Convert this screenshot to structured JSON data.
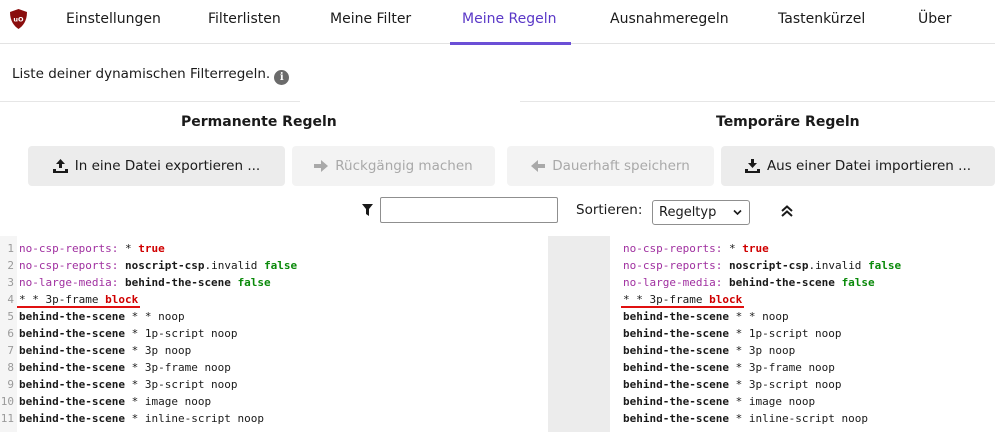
{
  "nav": {
    "logo_icon": "ublock-origin-shield-icon",
    "tabs": [
      "Einstellungen",
      "Filterlisten",
      "Meine Filter",
      "Meine Regeln",
      "Ausnahmeregeln",
      "Tastenkürzel",
      "Über"
    ],
    "active_tab": "Meine Regeln"
  },
  "description": "Liste deiner dynamischen Filterregeln.",
  "columns": {
    "permanent_title": "Permanente Regeln",
    "temporary_title": "Temporäre Regeln"
  },
  "buttons": {
    "export": "In eine Datei exportieren ...",
    "revert": "Rückgängig machen",
    "commit": "Dauerhaft speichern",
    "import": "Aus einer Datei importieren ..."
  },
  "filter": {
    "value": "",
    "placeholder": ""
  },
  "sort": {
    "label": "Sortieren:",
    "selected": "Regeltyp"
  },
  "colors": {
    "accent": "#6b4fd6",
    "keyword": "#a030a0",
    "true_value": "#d00000",
    "false_value": "#0a8a0a",
    "highlight": "#e01010"
  },
  "rules": [
    {
      "num": "1",
      "parts": [
        [
          "kw",
          "no-csp-reports:"
        ],
        [
          "",
          " * "
        ],
        [
          "red",
          "true"
        ]
      ]
    },
    {
      "num": "2",
      "parts": [
        [
          "kw",
          "no-csp-reports:"
        ],
        [
          "",
          " "
        ],
        [
          "b",
          "noscript-csp"
        ],
        [
          "",
          ".invalid "
        ],
        [
          "green",
          "false"
        ]
      ]
    },
    {
      "num": "3",
      "parts": [
        [
          "kw",
          "no-large-media:"
        ],
        [
          "",
          " "
        ],
        [
          "b",
          "behind-the-scene"
        ],
        [
          "",
          " "
        ],
        [
          "green",
          "false"
        ]
      ]
    },
    {
      "num": "4",
      "parts": [
        [
          "",
          "* * 3p-frame "
        ],
        [
          "red",
          "block"
        ]
      ]
    },
    {
      "num": "5",
      "parts": [
        [
          "b",
          "behind-the-scene"
        ],
        [
          "",
          " * * noop"
        ]
      ]
    },
    {
      "num": "6",
      "parts": [
        [
          "b",
          "behind-the-scene"
        ],
        [
          "",
          " * 1p-script noop"
        ]
      ]
    },
    {
      "num": "7",
      "parts": [
        [
          "b",
          "behind-the-scene"
        ],
        [
          "",
          " * 3p noop"
        ]
      ]
    },
    {
      "num": "8",
      "parts": [
        [
          "b",
          "behind-the-scene"
        ],
        [
          "",
          " * 3p-frame noop"
        ]
      ]
    },
    {
      "num": "9",
      "parts": [
        [
          "b",
          "behind-the-scene"
        ],
        [
          "",
          " * 3p-script noop"
        ]
      ]
    },
    {
      "num": "10",
      "parts": [
        [
          "b",
          "behind-the-scene"
        ],
        [
          "",
          " * image noop"
        ]
      ]
    },
    {
      "num": "11",
      "parts": [
        [
          "b",
          "behind-the-scene"
        ],
        [
          "",
          " * inline-script noop"
        ]
      ]
    }
  ],
  "highlighted_rule_index": 3
}
